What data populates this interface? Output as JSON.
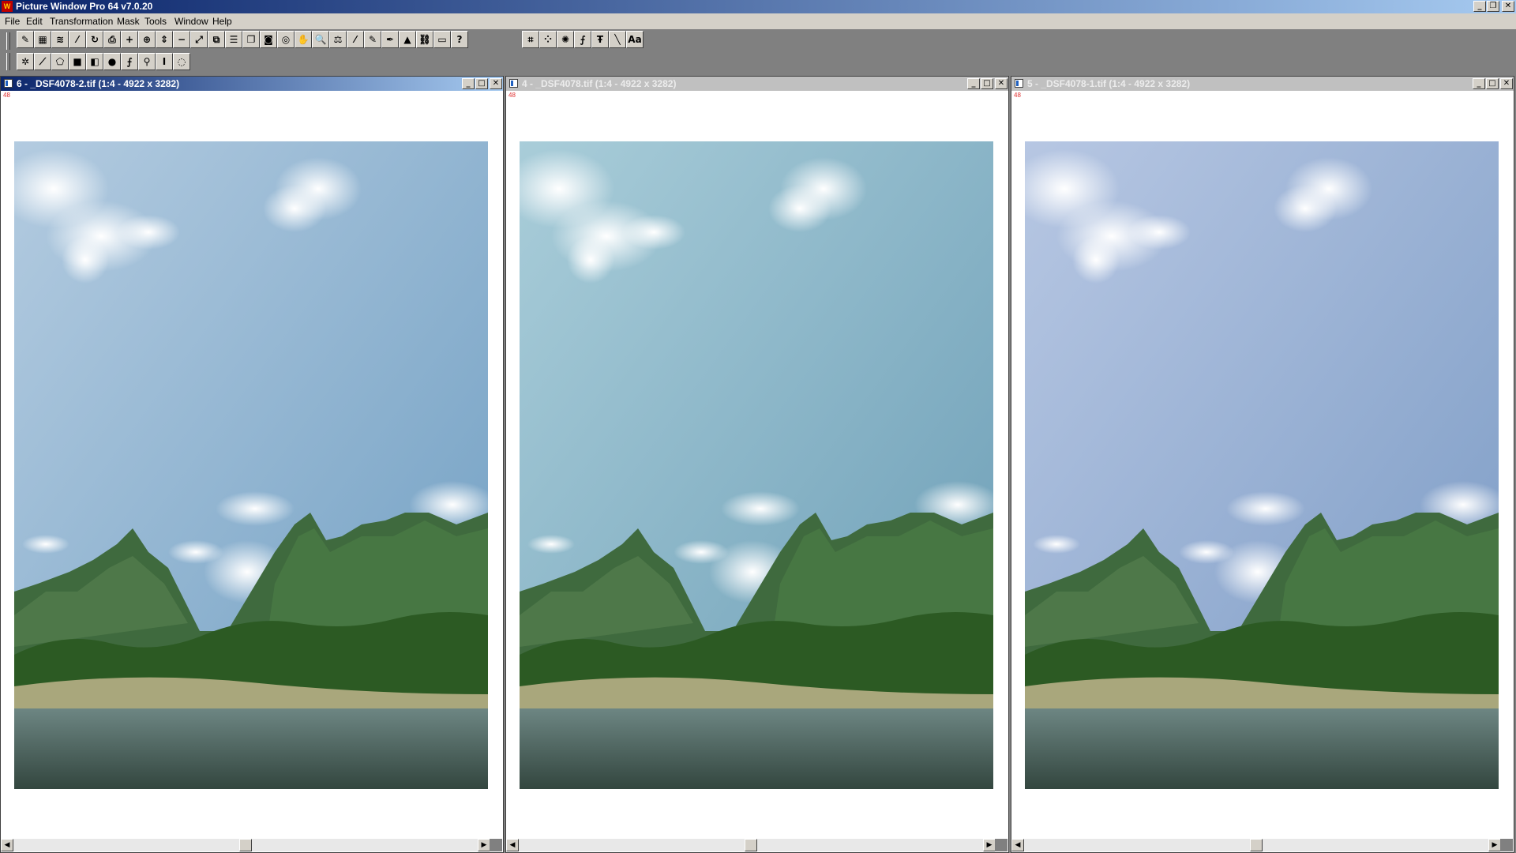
{
  "app": {
    "title": "Picture Window Pro 64  v7.0.20",
    "icon_label": "W",
    "window_buttons": [
      "minimize-icon",
      "restore-icon",
      "close-icon"
    ]
  },
  "menu": [
    "File",
    "Edit",
    "Transformation",
    "Mask",
    "Tools",
    "Window",
    "Help"
  ],
  "toolbar_row1_group1": [
    "edit-icon",
    "grid-icon",
    "wave-icon",
    "brush-curve-icon",
    "rotate-icon",
    "print-icon",
    "add-icon",
    "zoom-fit-icon",
    "measure-icon",
    "subtract-icon",
    "expand-icon",
    "copy-icon",
    "list-icon",
    "layers-icon",
    "camera-icon",
    "circle-arrow-icon",
    "hand-icon",
    "zoom-icon",
    "compare-icon",
    "pen-icon",
    "pencil-icon",
    "brush-icon",
    "histogram-icon",
    "link-icon",
    "scanner-icon",
    "help-icon"
  ],
  "toolbar_row1_glyphs": [
    "✎",
    "▦",
    "≋",
    "⁄",
    "↻",
    "⎙",
    "+",
    "⊕",
    "⇕",
    "−",
    "⤢",
    "⧉",
    "☰",
    "❐",
    "◙",
    "◎",
    "✋",
    "🔍",
    "⚖",
    "⁄",
    "✎",
    "✒",
    "▲",
    "⛓",
    "▭",
    "?"
  ],
  "toolbar_row1_group2": [
    "crop-icon",
    "points-icon",
    "sparkle-icon",
    "curve-adjust-icon",
    "text-tool-icon",
    "line-icon",
    "font-icon"
  ],
  "toolbar_row1_group2_glyphs": [
    "⌗",
    "⁘",
    "✺",
    "⨍",
    "Ŧ",
    "╲",
    "Aa"
  ],
  "toolbar_row2": [
    "magic-icon",
    "gradient-line-icon",
    "shape-icon",
    "black-square-icon",
    "half-square-icon",
    "sphere-icon",
    "curve-icon",
    "dodge-icon",
    "text-cursor-icon",
    "stamp-icon"
  ],
  "toolbar_row2_glyphs": [
    "✲",
    "⟋",
    "⬠",
    "■",
    "◧",
    "●",
    "⨍",
    "⚲",
    "I",
    "◌"
  ],
  "windows": [
    {
      "title": "6 - _DSF4078-2.tif (1:4 - 4922 x 3282)",
      "bit_depth": "48",
      "active": true,
      "tone": "warm"
    },
    {
      "title": "4 - _DSF4078.tif (1:4 - 4922 x 3282)",
      "bit_depth": "48",
      "active": false,
      "tone": "cyan"
    },
    {
      "title": "5 - _DSF4078-1.tif (1:4 - 4922 x 3282)",
      "bit_depth": "48",
      "active": false,
      "tone": "cool"
    }
  ],
  "colors": {
    "titlebar_start": "#0a246a",
    "titlebar_end": "#a6caf0",
    "chrome": "#d4d0c8",
    "workspace": "#808080",
    "sky_warm": [
      "#b3cbe0",
      "#6f9ec2"
    ],
    "sky_cyan": [
      "#a9cdd9",
      "#6a9cb5"
    ],
    "sky_cool": [
      "#b7c7e3",
      "#7a9ac4"
    ]
  }
}
